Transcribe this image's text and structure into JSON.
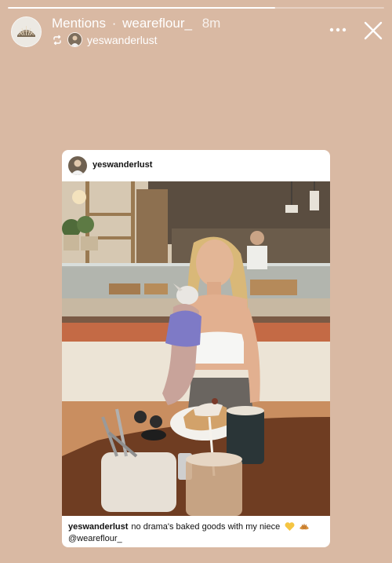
{
  "story": {
    "progress": 0.71,
    "header": {
      "title": "Mentions",
      "separator": "·",
      "account": "weareflour_",
      "time": "8m",
      "reposted_from": "yeswanderlust",
      "icons": [
        "profile-avatar",
        "repost-icon",
        "more-icon",
        "close-icon"
      ]
    }
  },
  "post": {
    "username": "yeswanderlust",
    "caption_username": "yeswanderlust",
    "caption_text": "no drama's baked goods with my niece",
    "caption_mention": "@weareflour_",
    "caption_emojis": [
      "yellow-heart-emoji",
      "croissant-emoji"
    ]
  },
  "colors": {
    "background": "#d9b9a3",
    "card": "#ffffff",
    "header_text": "#ffffff",
    "heart": "#f5c542"
  }
}
